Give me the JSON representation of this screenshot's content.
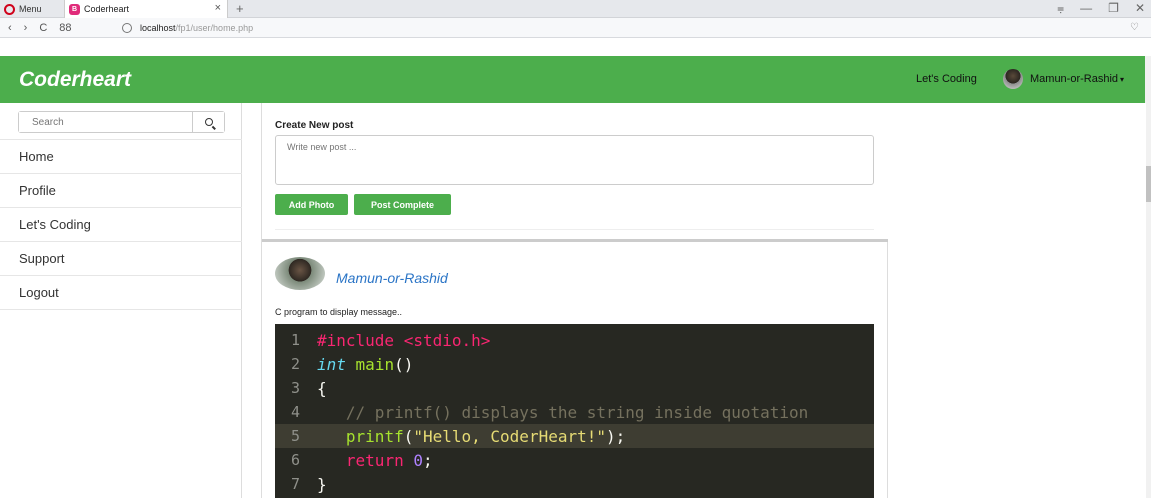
{
  "browser": {
    "menu_label": "Menu",
    "tab_title": "Coderheart",
    "tab_favicon": "B",
    "tab_close": "×",
    "new_tab": "+",
    "url_host": "localhost",
    "url_path": "/fp1/user/home.php",
    "back": "‹",
    "forward": "›",
    "reload": "C",
    "speed_dial": "88",
    "heart": "♡",
    "win_controls": [
      "⩦",
      "—",
      "❐",
      "✕"
    ]
  },
  "navbar": {
    "brand": "Coderheart",
    "link": "Let's Coding",
    "user_name": "Mamun-or-Rashid",
    "caret": "▾"
  },
  "sidebar": {
    "search_placeholder": "Search",
    "items": [
      {
        "label": "Home"
      },
      {
        "label": "Profile"
      },
      {
        "label": "Let's Coding"
      },
      {
        "label": "Support"
      },
      {
        "label": "Logout"
      }
    ]
  },
  "create_post": {
    "title": "Create New post",
    "placeholder": "Write new post ...",
    "add_photo": "Add Photo",
    "post_complete": "Post Complete"
  },
  "post": {
    "author": "Mamun-or-Rashid",
    "caption": "C program to display message..",
    "code_lines": [
      {
        "num": "1",
        "text": "#include <stdio.h>"
      },
      {
        "num": "2",
        "text": "int main()"
      },
      {
        "num": "3",
        "text": "{"
      },
      {
        "num": "4",
        "text": "   // printf() displays the string inside quotation"
      },
      {
        "num": "5",
        "text": "   printf(\"Hello, CoderHeart!\");"
      },
      {
        "num": "6",
        "text": "   return 0;"
      },
      {
        "num": "7",
        "text": "}"
      }
    ]
  },
  "colors": {
    "brand_green": "#4cae4c",
    "link_blue": "#2a74c6",
    "code_bg": "#272822"
  }
}
